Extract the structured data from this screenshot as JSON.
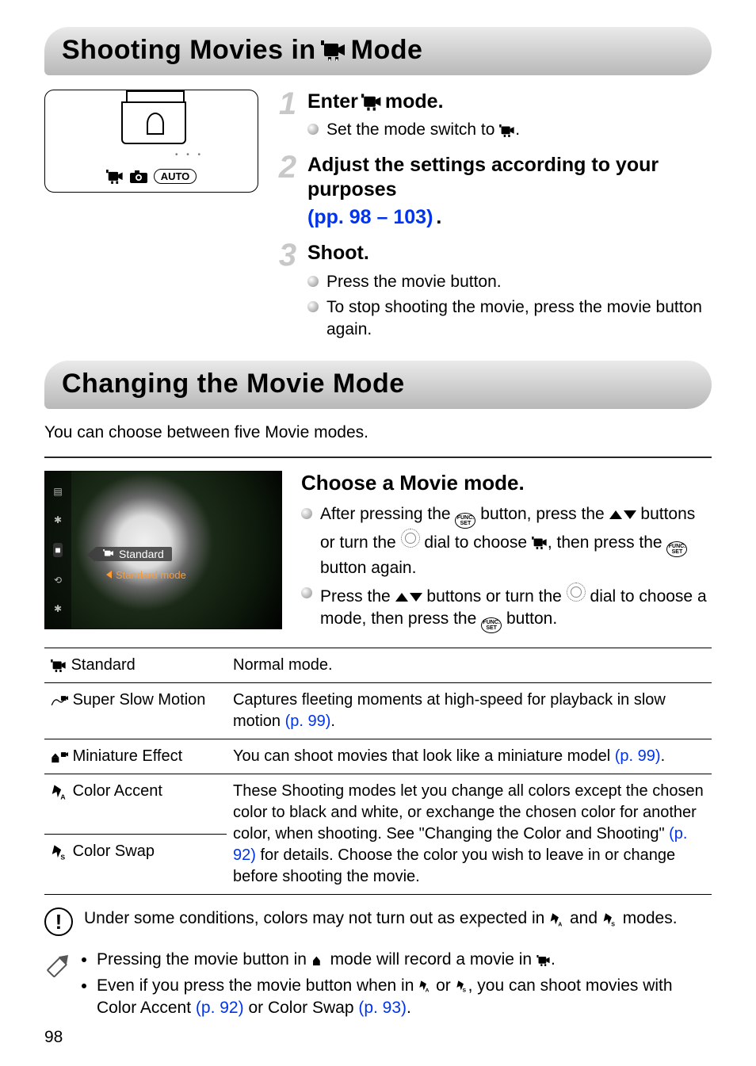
{
  "header1": {
    "pre": "Shooting Movies in ",
    "post": " Mode"
  },
  "camera_modes": {
    "auto": "AUTO"
  },
  "steps": [
    {
      "num": "1",
      "title_pre": "Enter ",
      "title_post": " mode.",
      "bullets": [
        {
          "pre": "Set the mode switch to ",
          "post": "."
        }
      ]
    },
    {
      "num": "2",
      "title_pre": "Adjust the settings according to your purposes ",
      "link": "(pp. 98 – 103)",
      "title_post": "."
    },
    {
      "num": "3",
      "title": "Shoot.",
      "bullets": [
        {
          "text": "Press the movie button."
        },
        {
          "text": "To stop shooting the movie, press the movie button again."
        }
      ]
    }
  ],
  "header2": "Changing the Movie Mode",
  "intro": "You can choose between five Movie modes.",
  "lcd": {
    "banner": "Standard",
    "sub": "Standard mode"
  },
  "choose": {
    "title": "Choose a Movie mode.",
    "b1": {
      "a": "After pressing the ",
      "b": " button, press the ",
      "c": " buttons or turn the ",
      "d": " dial to choose ",
      "e": ", then press the ",
      "f": " button again."
    },
    "b2": {
      "a": "Press the ",
      "b": " buttons or turn the ",
      "c": " dial to choose a mode, then press the ",
      "d": " button."
    }
  },
  "table": {
    "rows": [
      {
        "name": "Standard",
        "desc": "Normal mode."
      },
      {
        "name": "Super Slow Motion",
        "desc_pre": "Captures fleeting moments at high-speed for playback in slow motion ",
        "link": "(p. 99)",
        "desc_post": "."
      },
      {
        "name": "Miniature Effect",
        "desc_pre": "You can shoot movies that look like a miniature model ",
        "link": "(p. 99)",
        "desc_post": "."
      },
      {
        "name": "Color Accent",
        "combined_a": "These Shooting modes let you change all colors except the chosen color to black and white, or exchange the chosen color "
      },
      {
        "name": "Color Swap",
        "combined_b": "for another color, when shooting. See \"Changing the Color and Shooting\" ",
        "link": "(p. 92)",
        "combined_c": " for details. Choose the color you wish to leave in or change before shooting the movie."
      }
    ]
  },
  "warning": {
    "a": "Under some conditions, colors may not turn out as expected in ",
    "b": " and ",
    "c": " modes."
  },
  "tips": {
    "t1": {
      "a": "Pressing the movie button in ",
      "b": " mode will record a movie in ",
      "c": "."
    },
    "t2": {
      "a": "Even if you press the movie button when in ",
      "b": " or ",
      "c": ", you can shoot movies with Color Accent ",
      "link1": "(p. 92)",
      "d": " or Color Swap ",
      "link2": "(p. 93)",
      "e": "."
    }
  },
  "page_number": "98"
}
